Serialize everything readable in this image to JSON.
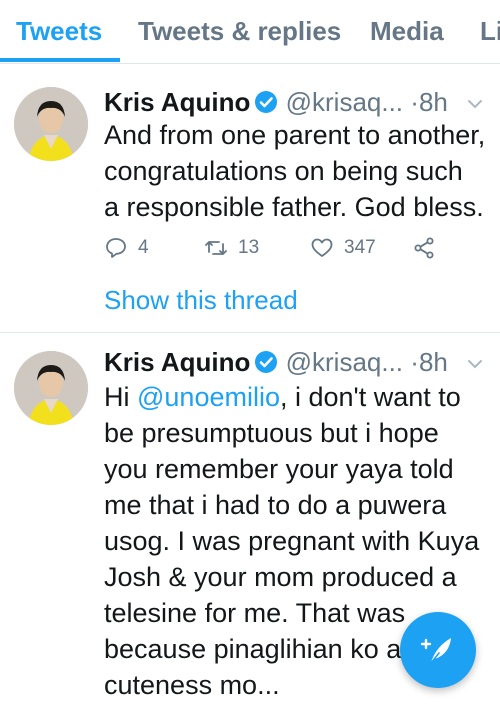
{
  "tabs": [
    {
      "label": "Tweets",
      "active": true
    },
    {
      "label": "Tweets & replies",
      "active": false
    },
    {
      "label": "Media",
      "active": false
    },
    {
      "label": "Li",
      "active": false
    }
  ],
  "colors": {
    "accent": "#1da1f2",
    "secondary_text": "#657786",
    "primary_text": "#14171a",
    "avatar_outfit": "#f2e01c"
  },
  "tweets": [
    {
      "name": "Kris Aquino",
      "handle": "@krisaq...",
      "separator": "·",
      "time": "8h",
      "lines": [
        "And from one parent to another,",
        "congratulations on being such",
        "a responsible father. God bless."
      ],
      "replies": "4",
      "retweets": "13",
      "likes": "347",
      "show_thread": "Show this thread"
    },
    {
      "name": "Kris Aquino",
      "handle": "@krisaq...",
      "separator": "·",
      "time": "8h",
      "first_line_prefix": "Hi ",
      "first_line_mention": "@unoemilio",
      "first_line_suffix": ", i don't want to",
      "lines": [
        "be presumptuous but i hope",
        "you remember your yaya told",
        "me that i had to do a puwera",
        "usog. I was pregnant with Kuya",
        "Josh & your mom produced a",
        "telesine for me. That was",
        "because pinaglihian ko a",
        "cuteness mo..."
      ]
    }
  ],
  "icons": {
    "verified": "verified-badge-icon",
    "chevron": "chevron-down-icon",
    "reply": "reply-icon",
    "retweet": "retweet-icon",
    "like": "heart-icon",
    "share": "share-icon",
    "compose": "compose-tweet-icon"
  }
}
